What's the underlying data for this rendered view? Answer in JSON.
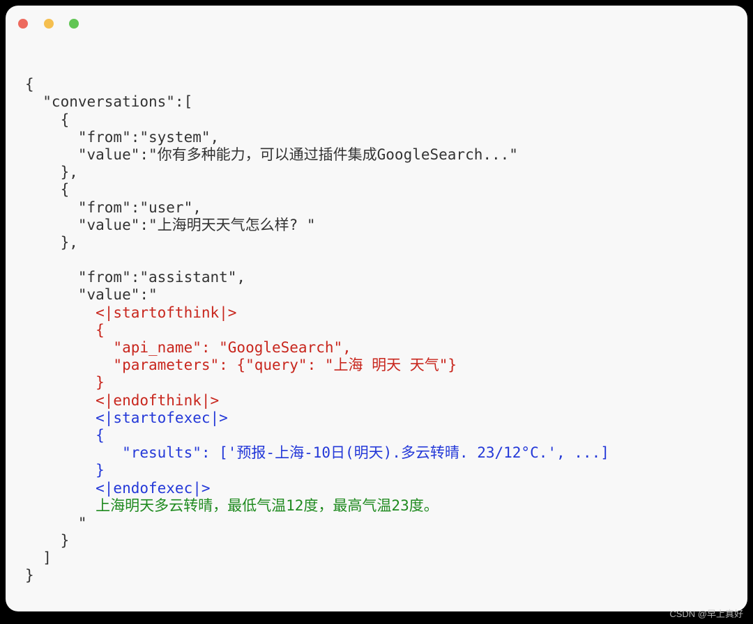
{
  "watermark": "CSDN @早上真好",
  "colors": {
    "think": "#c8261d",
    "exec": "#2338d8",
    "answer": "#1f8a1f",
    "text": "#333333",
    "bg": "#f8f8f8"
  },
  "window_controls": [
    "close",
    "minimize",
    "zoom"
  ],
  "code": {
    "l1": "{",
    "l2": "  \"conversations\":[",
    "l3": "    {",
    "l4": "      \"from\":\"system\",",
    "l5": "      \"value\":\"你有多种能力，可以通过插件集成GoogleSearch...\"",
    "l6": "    },",
    "l7": "    {",
    "l8": "      \"from\":\"user\",",
    "l9": "      \"value\":\"上海明天天气怎么样? \"",
    "l10": "    },",
    "l11": "",
    "l12": "      \"from\":\"assistant\",",
    "l13": "      \"value\":\"",
    "l14": "        <|startofthink|>",
    "l15": "        {",
    "l16": "          \"api_name\": \"GoogleSearch\",",
    "l17": "          \"parameters\": {\"query\": \"上海 明天 天气\"}",
    "l18": "        }",
    "l19": "        <|endofthink|>",
    "l20": "        <|startofexec|>",
    "l21": "        {",
    "l22": "           \"results\": ['预报-上海-10日(明天).多云转晴. 23/12°C.', ...]",
    "l23": "        }",
    "l24": "        <|endofexec|>",
    "l25": "        上海明天多云转晴，最低气温12度，最高气温23度。",
    "l26": "      \"",
    "l27": "    }",
    "l28": "  ]",
    "l29": "}"
  },
  "structured_json": {
    "conversations": [
      {
        "from": "system",
        "value": "你有多种能力，可以通过插件集成GoogleSearch..."
      },
      {
        "from": "user",
        "value": "上海明天天气怎么样? "
      },
      {
        "from": "assistant",
        "value": {
          "think": {
            "api_name": "GoogleSearch",
            "parameters": {
              "query": "上海 明天 天气"
            }
          },
          "exec": {
            "results": [
              "预报-上海-10日(明天).多云转晴. 23/12°C.",
              "..."
            ]
          },
          "answer": "上海明天多云转晴，最低气温12度，最高气温23度。"
        }
      }
    ]
  }
}
